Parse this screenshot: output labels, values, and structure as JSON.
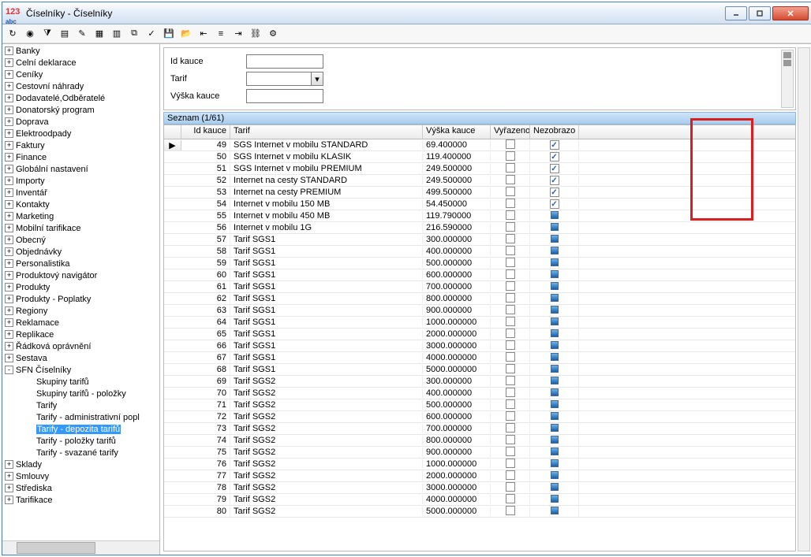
{
  "window": {
    "title": "Číselníky - Číselníky"
  },
  "form": {
    "idkauce_label": "Id kauce",
    "tarif_label": "Tarif",
    "vyska_label": "Výška kauce",
    "idkauce_value": "",
    "tarif_value": "",
    "vyska_value": ""
  },
  "seznam_header": "Seznam (1/61)",
  "tree": [
    {
      "label": "Banky",
      "exp": "+"
    },
    {
      "label": "Celní deklarace",
      "exp": "+"
    },
    {
      "label": "Ceníky",
      "exp": "+"
    },
    {
      "label": "Cestovní náhrady",
      "exp": "+"
    },
    {
      "label": "Dodavatelé,Odběratelé",
      "exp": "+"
    },
    {
      "label": "Donatorský program",
      "exp": "+"
    },
    {
      "label": "Doprava",
      "exp": "+"
    },
    {
      "label": "Elektroodpady",
      "exp": "+"
    },
    {
      "label": "Faktury",
      "exp": "+"
    },
    {
      "label": "Finance",
      "exp": "+"
    },
    {
      "label": "Globální nastavení",
      "exp": "+"
    },
    {
      "label": "Importy",
      "exp": "+"
    },
    {
      "label": "Inventář",
      "exp": "+"
    },
    {
      "label": "Kontakty",
      "exp": "+"
    },
    {
      "label": "Marketing",
      "exp": "+"
    },
    {
      "label": "Mobilní tarifikace",
      "exp": "+"
    },
    {
      "label": "Obecný",
      "exp": "+"
    },
    {
      "label": "Objednávky",
      "exp": "+"
    },
    {
      "label": "Personalistika",
      "exp": "+"
    },
    {
      "label": "Produktový navigátor",
      "exp": "+"
    },
    {
      "label": "Produkty",
      "exp": "+"
    },
    {
      "label": "Produkty - Poplatky",
      "exp": "+"
    },
    {
      "label": "Regiony",
      "exp": "+"
    },
    {
      "label": "Reklamace",
      "exp": "+"
    },
    {
      "label": "Replikace",
      "exp": "+"
    },
    {
      "label": "Řádková oprávnění",
      "exp": "+"
    },
    {
      "label": "Sestava",
      "exp": "+"
    },
    {
      "label": "SFN Číselníky",
      "exp": "-",
      "children": [
        {
          "label": "Skupiny tarifů"
        },
        {
          "label": "Skupiny tarifů - položky"
        },
        {
          "label": "Tarify"
        },
        {
          "label": "Tarify - administrativní popl"
        },
        {
          "label": "Tarify - depozita tarifů",
          "selected": true
        },
        {
          "label": "Tarify - položky tarifů"
        },
        {
          "label": "Tarify - svazané tarify"
        }
      ]
    },
    {
      "label": "Sklady",
      "exp": "+"
    },
    {
      "label": "Smlouvy",
      "exp": "+"
    },
    {
      "label": "Střediska",
      "exp": "+"
    },
    {
      "label": "Tarifikace",
      "exp": "+"
    }
  ],
  "grid": {
    "columns": {
      "id": "Id kauce",
      "tarif": "Tarif",
      "vyska": "Výška kauce",
      "vyr": "Vyřazeno",
      "nez": "Nezobrazo"
    },
    "rows": [
      {
        "id": "49",
        "tarif": "SGS Internet v mobilu STANDARD",
        "vyska": "69.400000",
        "vyr": false,
        "nez": "check",
        "current": true
      },
      {
        "id": "50",
        "tarif": "SGS Internet v mobilu KLASIK",
        "vyska": "119.400000",
        "vyr": false,
        "nez": "check"
      },
      {
        "id": "51",
        "tarif": "SGS Internet v mobilu PREMIUM",
        "vyska": "249.500000",
        "vyr": false,
        "nez": "check"
      },
      {
        "id": "52",
        "tarif": "Internet na cesty STANDARD",
        "vyska": "249.500000",
        "vyr": false,
        "nez": "check"
      },
      {
        "id": "53",
        "tarif": "Internet na cesty PREMIUM",
        "vyska": "499.500000",
        "vyr": false,
        "nez": "check"
      },
      {
        "id": "54",
        "tarif": "Internet v mobilu 150 MB",
        "vyska": "54.450000",
        "vyr": false,
        "nez": "check"
      },
      {
        "id": "55",
        "tarif": "Internet v mobilu 450 MB",
        "vyska": "119.790000",
        "vyr": false,
        "nez": "sq"
      },
      {
        "id": "56",
        "tarif": "Internet v mobilu 1G",
        "vyska": "216.590000",
        "vyr": false,
        "nez": "sq"
      },
      {
        "id": "57",
        "tarif": "Tarif SGS1",
        "vyska": "300.000000",
        "vyr": false,
        "nez": "sq"
      },
      {
        "id": "58",
        "tarif": "Tarif SGS1",
        "vyska": "400.000000",
        "vyr": false,
        "nez": "sq"
      },
      {
        "id": "59",
        "tarif": "Tarif SGS1",
        "vyska": "500.000000",
        "vyr": false,
        "nez": "sq"
      },
      {
        "id": "60",
        "tarif": "Tarif SGS1",
        "vyska": "600.000000",
        "vyr": false,
        "nez": "sq"
      },
      {
        "id": "61",
        "tarif": "Tarif SGS1",
        "vyska": "700.000000",
        "vyr": false,
        "nez": "sq"
      },
      {
        "id": "62",
        "tarif": "Tarif SGS1",
        "vyska": "800.000000",
        "vyr": false,
        "nez": "sq"
      },
      {
        "id": "63",
        "tarif": "Tarif SGS1",
        "vyska": "900.000000",
        "vyr": false,
        "nez": "sq"
      },
      {
        "id": "64",
        "tarif": "Tarif SGS1",
        "vyska": "1000.000000",
        "vyr": false,
        "nez": "sq"
      },
      {
        "id": "65",
        "tarif": "Tarif SGS1",
        "vyska": "2000.000000",
        "vyr": false,
        "nez": "sq"
      },
      {
        "id": "66",
        "tarif": "Tarif SGS1",
        "vyska": "3000.000000",
        "vyr": false,
        "nez": "sq"
      },
      {
        "id": "67",
        "tarif": "Tarif SGS1",
        "vyska": "4000.000000",
        "vyr": false,
        "nez": "sq"
      },
      {
        "id": "68",
        "tarif": "Tarif SGS1",
        "vyska": "5000.000000",
        "vyr": false,
        "nez": "sq"
      },
      {
        "id": "69",
        "tarif": "Tarif SGS2",
        "vyska": "300.000000",
        "vyr": false,
        "nez": "sq"
      },
      {
        "id": "70",
        "tarif": "Tarif SGS2",
        "vyska": "400.000000",
        "vyr": false,
        "nez": "sq"
      },
      {
        "id": "71",
        "tarif": "Tarif SGS2",
        "vyska": "500.000000",
        "vyr": false,
        "nez": "sq"
      },
      {
        "id": "72",
        "tarif": "Tarif SGS2",
        "vyska": "600.000000",
        "vyr": false,
        "nez": "sq"
      },
      {
        "id": "73",
        "tarif": "Tarif SGS2",
        "vyska": "700.000000",
        "vyr": false,
        "nez": "sq"
      },
      {
        "id": "74",
        "tarif": "Tarif SGS2",
        "vyska": "800.000000",
        "vyr": false,
        "nez": "sq"
      },
      {
        "id": "75",
        "tarif": "Tarif SGS2",
        "vyska": "900.000000",
        "vyr": false,
        "nez": "sq"
      },
      {
        "id": "76",
        "tarif": "Tarif SGS2",
        "vyska": "1000.000000",
        "vyr": false,
        "nez": "sq"
      },
      {
        "id": "77",
        "tarif": "Tarif SGS2",
        "vyska": "2000.000000",
        "vyr": false,
        "nez": "sq"
      },
      {
        "id": "78",
        "tarif": "Tarif SGS2",
        "vyska": "3000.000000",
        "vyr": false,
        "nez": "sq"
      },
      {
        "id": "79",
        "tarif": "Tarif SGS2",
        "vyska": "4000.000000",
        "vyr": false,
        "nez": "sq"
      },
      {
        "id": "80",
        "tarif": "Tarif SGS2",
        "vyska": "5000.000000",
        "vyr": false,
        "nez": "sq"
      }
    ]
  },
  "toolbar_icons": [
    "refresh",
    "globe",
    "filter-funnel",
    "filter",
    "edit",
    "new",
    "excel",
    "copy",
    "check",
    "save",
    "open",
    "indent-left",
    "indent-center",
    "indent-right",
    "link",
    "settings"
  ]
}
